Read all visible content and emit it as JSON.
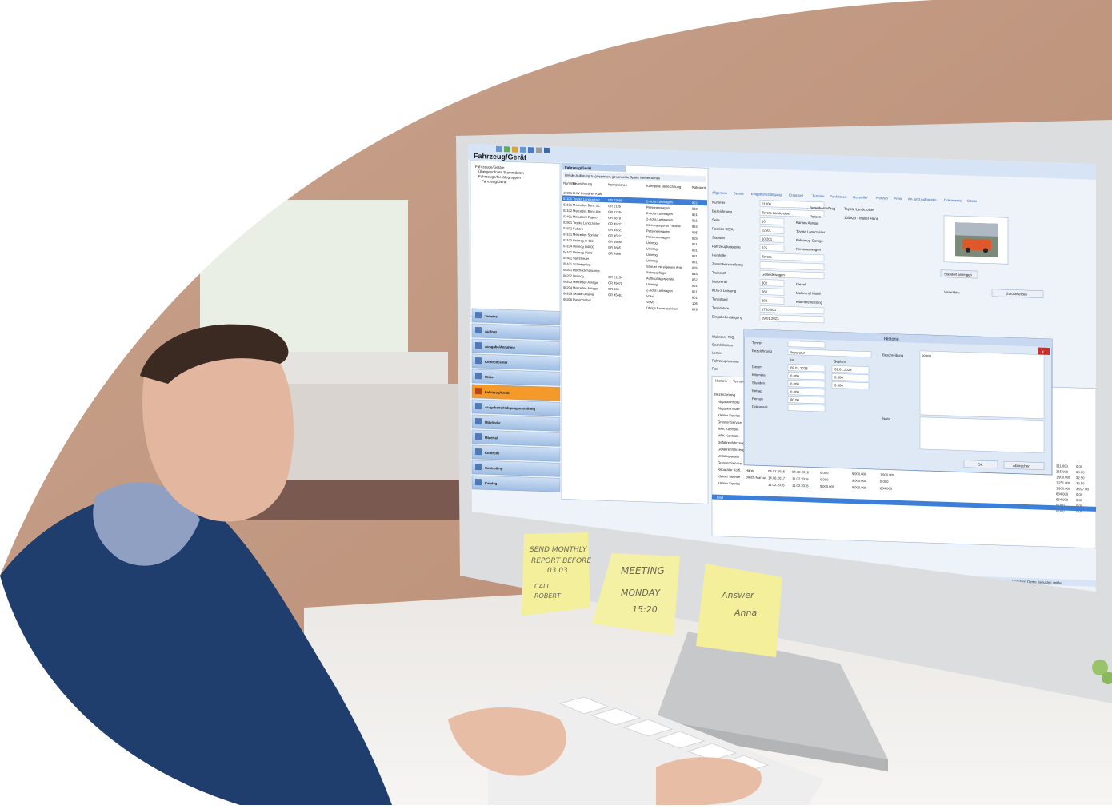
{
  "app": {
    "module_title": "Fahrzeug/Gerät",
    "tab_label": "Fahrzeug/Gerät",
    "group_hint": "Um die Auflistung zu gruppieren, gewünschte Spalte hierher ziehen",
    "tree": [
      "Fahrzeuge/Geräte",
      "Übergeordnete Stammdaten",
      "Fahrzeuge/Gerätegruppen",
      "Fahrzeug/Gerät"
    ],
    "nav": [
      "Termine",
      "Auftrag",
      "Ausgabe/Annahme",
      "Kontrollcenter",
      "Mieter",
      "Fahrzeug/Gerät",
      "Aufgabenerledigungserstellung",
      "Mitglieder",
      "Material",
      "Kontrolle",
      "Controlling",
      "Katalog"
    ],
    "list_columns": [
      "Nummer",
      "Bezeichnung",
      "Kennzeichen",
      "Kategorie Bezeichnung",
      "Kategorie"
    ],
    "list_rows": [
      [
        "10001",
        "LKW Container Klas",
        "",
        "",
        ""
      ],
      [
        "01106",
        "Toyota Landcruiser",
        "GR 73909",
        "2-Achs Lastwagen",
        "822"
      ],
      [
        "02101",
        "Mercedes Benz SL",
        "GR 2135",
        "Personenwagen",
        "818"
      ],
      [
        "02102",
        "Mercedes Benz Ate",
        "GR 27354",
        "2-Achs Lastwagen",
        "821"
      ],
      [
        "02401",
        "Mitsubishi Pajero",
        "GR 5878",
        "2-Achs Lastwagen",
        "821"
      ],
      [
        "02601",
        "Toyota Landcruiser",
        "GR 45221",
        "Kleintransporter / Busse",
        "824"
      ],
      [
        "02602",
        "Subaru",
        "GR 45221",
        "Personenwagen",
        "825"
      ],
      [
        "03101",
        "Mercedes Sprinter",
        "GR 45221",
        "Personenwagen",
        "825"
      ],
      [
        "03103",
        "Unimog U 400",
        "GR 85555",
        "Unimog",
        "831"
      ],
      [
        "03104",
        "Unimog U4000",
        "GR 5885",
        "Unimog",
        "831"
      ],
      [
        "04101",
        "Unimog U300",
        "GR 4566",
        "Unimog",
        "831"
      ],
      [
        "04501",
        "Salzstreuer",
        "",
        "Unimog",
        "831"
      ],
      [
        "05101",
        "Schneepflug",
        "",
        "Streuer mit eigenem Antr.",
        "835"
      ],
      [
        "06201",
        "Holzhackmaschine",
        "",
        "Schneepflüge",
        "845"
      ],
      [
        "06202",
        "Unimog",
        "GR 21254",
        "Aufbauträgergeräte",
        "852"
      ],
      [
        "06203",
        "Mercedes Antego",
        "GR 45478",
        "Unimog",
        "831"
      ],
      [
        "06204",
        "Mercedes Antego",
        "GR 569",
        "2-Achs Lastwagen",
        "821"
      ],
      [
        "06205",
        "Skoda Octavia",
        "GR 45481",
        "Volvo",
        "801"
      ],
      [
        "06206",
        "Rasenmäher",
        "",
        "Volvo",
        "105"
      ],
      [
        "",
        "",
        "",
        "Übrige Baumaschinen",
        "879"
      ]
    ],
    "detail_tabs": [
      "Allgemein",
      "Details",
      "Eingabebestätigung",
      "Ersatzteil",
      "Termine",
      "Funktionen",
      "Hersteller",
      "Notizen",
      "Preis",
      "An- und Aufbauten",
      "Dokumente",
      "Historie"
    ],
    "detail_fields": [
      {
        "label": "Nummer",
        "value": "01000"
      },
      {
        "label": "Bezeichnung",
        "value": "Toyota Landcruiser"
      },
      {
        "label": "Seite",
        "value": "10",
        "extra": "Kanton Aargau"
      },
      {
        "label": "Position BEBU",
        "value": "02501",
        "extra": "Toyota Landcruiser"
      },
      {
        "label": "Standort",
        "value": "10.201",
        "extra": "Fahrzeug-Garage"
      },
      {
        "label": "Fahrzeugkategorie",
        "value": "825",
        "extra": "Personenwagen"
      },
      {
        "label": "Hersteller",
        "value": "Toyota"
      },
      {
        "label": "Zusatzbeschreibung",
        "value": ""
      },
      {
        "label": "Treibstoff",
        "value": "Geländewagen"
      },
      {
        "label": "Motorenöl",
        "value": "802",
        "extra": "Diesel"
      },
      {
        "label": "KDA-3 Leistung",
        "value": "860",
        "extra": "Motorenöl Mobil"
      },
      {
        "label": "Tankstand",
        "value": "300",
        "extra": "Kilometerleistung"
      },
      {
        "label": "Tankdatum",
        "value": "1760.000"
      },
      {
        "label": "Eingabebestätigung",
        "value": "09.01.2023"
      }
    ],
    "right_labels": {
      "betreiber": "Betreiberauftrag",
      "betreiber_value": "Toyota Landcruiser",
      "person": "Person",
      "person_value": "105923 - Müller Hans",
      "standort_btn": "Standort anzeigen",
      "visiert": "Visiert bis:",
      "zuruecksetzen": "Zurücksetzen"
    },
    "lower_labels": [
      "Wahrsere T./Q.",
      "Suchkriterium",
      "Lenker",
      "Fahrzeugnummer",
      "Fax"
    ],
    "history_tabs": [
      "Historie",
      "Termine"
    ],
    "history_col_label": "Bezeichnung",
    "history_rows": [
      [
        "Abgaskontrolle",
        "",
        "",
        "",
        "",
        "",
        ""
      ],
      [
        "Abgaskontrolle",
        "",
        "",
        "",
        "",
        "",
        ""
      ],
      [
        "Kleiner Service",
        "",
        "",
        "",
        "",
        "",
        ""
      ],
      [
        "Grosser Service",
        "",
        "",
        "",
        "",
        "",
        ""
      ],
      [
        "MFK Kontrolle",
        "",
        "",
        "",
        "",
        "",
        ""
      ],
      [
        "MFK-Kontrolle",
        "Schneider Hans",
        "01.09.2004",
        "14.06.2004",
        "19'050.000",
        "21'000.000",
        "215.000"
      ],
      [
        "Gefahrenfahrzeug",
        "Hans",
        "08.08.2013",
        "01.06.2005",
        "20'500.000",
        "20'500.000",
        "215.000"
      ],
      [
        "Gefahrenfahrzeug",
        "Wolf Marc",
        "19.12.2007",
        "19.12.2007",
        "79'740.000",
        "70'000.000",
        "215.000"
      ],
      [
        "Unfallreparatur",
        "Kohler Roland",
        "09.08.2010",
        "01.12.2010",
        "99'574.000",
        "101'050.000",
        "1'349.000"
      ],
      [
        "Grosser Service",
        "",
        "01.12.2010",
        "01.12.2010",
        "101'050.000",
        "101'050.000",
        "1'549.000"
      ],
      [
        "Reparatur Kotfl.",
        "Hans",
        "04.02.2016",
        "04.02.2016",
        "0.000",
        "9'000.000",
        "1'900.000"
      ],
      [
        "Kleiner Service",
        "Bleich Marcus",
        "14.06.2017",
        "11.02.2016",
        "0.000",
        "9'000.000",
        "0.000"
      ],
      [
        "Kleiner Service",
        "",
        "11.02.2016",
        "11.02.2016",
        "9'000.000",
        "9'000.000",
        "634.000"
      ]
    ],
    "history_extra": [
      "311.000",
      "215.000",
      "1'900.000",
      "1'251.000",
      "1'900.000",
      "634.000",
      "634.000",
      "0.000",
      "0.000"
    ],
    "history_extra2": [
      "0.00",
      "60.00",
      "32.50",
      "32.50",
      "3'597.00",
      "0.00",
      "0.00",
      "0.00",
      "0.00"
    ],
    "history_total": "Total",
    "status_bar": "Mandant: Demo    Benutzer: müller",
    "dialog": {
      "title": "Historie",
      "termin_label": "Termin",
      "bezeichnung_label": "Bezeichnung",
      "bezeichnung_value": "Reparatur",
      "beschreibung_label": "Beschreibung",
      "beschreibung_value": "ooooo",
      "ist_label": "Ist",
      "geplant_label": "Geplant",
      "rows": [
        {
          "label": "Datum",
          "ist": "09.01.2023",
          "geplant": "09.01.2023"
        },
        {
          "label": "Kilometer",
          "ist": "0.000",
          "geplant": "0.000"
        },
        {
          "label": "Stunden",
          "ist": "0.000",
          "geplant": "0.000"
        },
        {
          "label": "Betrag",
          "ist": "0.000",
          "geplant": ""
        },
        {
          "label": "Person",
          "ist": "80.00",
          "geplant": ""
        },
        {
          "label": "Dokument",
          "ist": "",
          "geplant": ""
        }
      ],
      "notiz_label": "Notiz",
      "ok": "OK",
      "cancel": "Abbrechen",
      "close": "x"
    }
  },
  "notes": [
    {
      "lines": [
        "SEND MONTHLY",
        "REPORT BEFORE",
        "03.03",
        "CALL",
        "ROBERT"
      ]
    },
    {
      "lines": [
        "MEETING",
        "MONDAY",
        "15:20"
      ]
    },
    {
      "lines": [
        "Answer",
        "Anna"
      ]
    }
  ],
  "colors": {
    "ui_blue": "#5a8fd4",
    "ui_selected": "#3d7fd6",
    "nav_orange": "#f39a2b",
    "note_yellow": "#f3ef9a",
    "jacket": "#1f3e6e",
    "wall": "#c9a890"
  }
}
